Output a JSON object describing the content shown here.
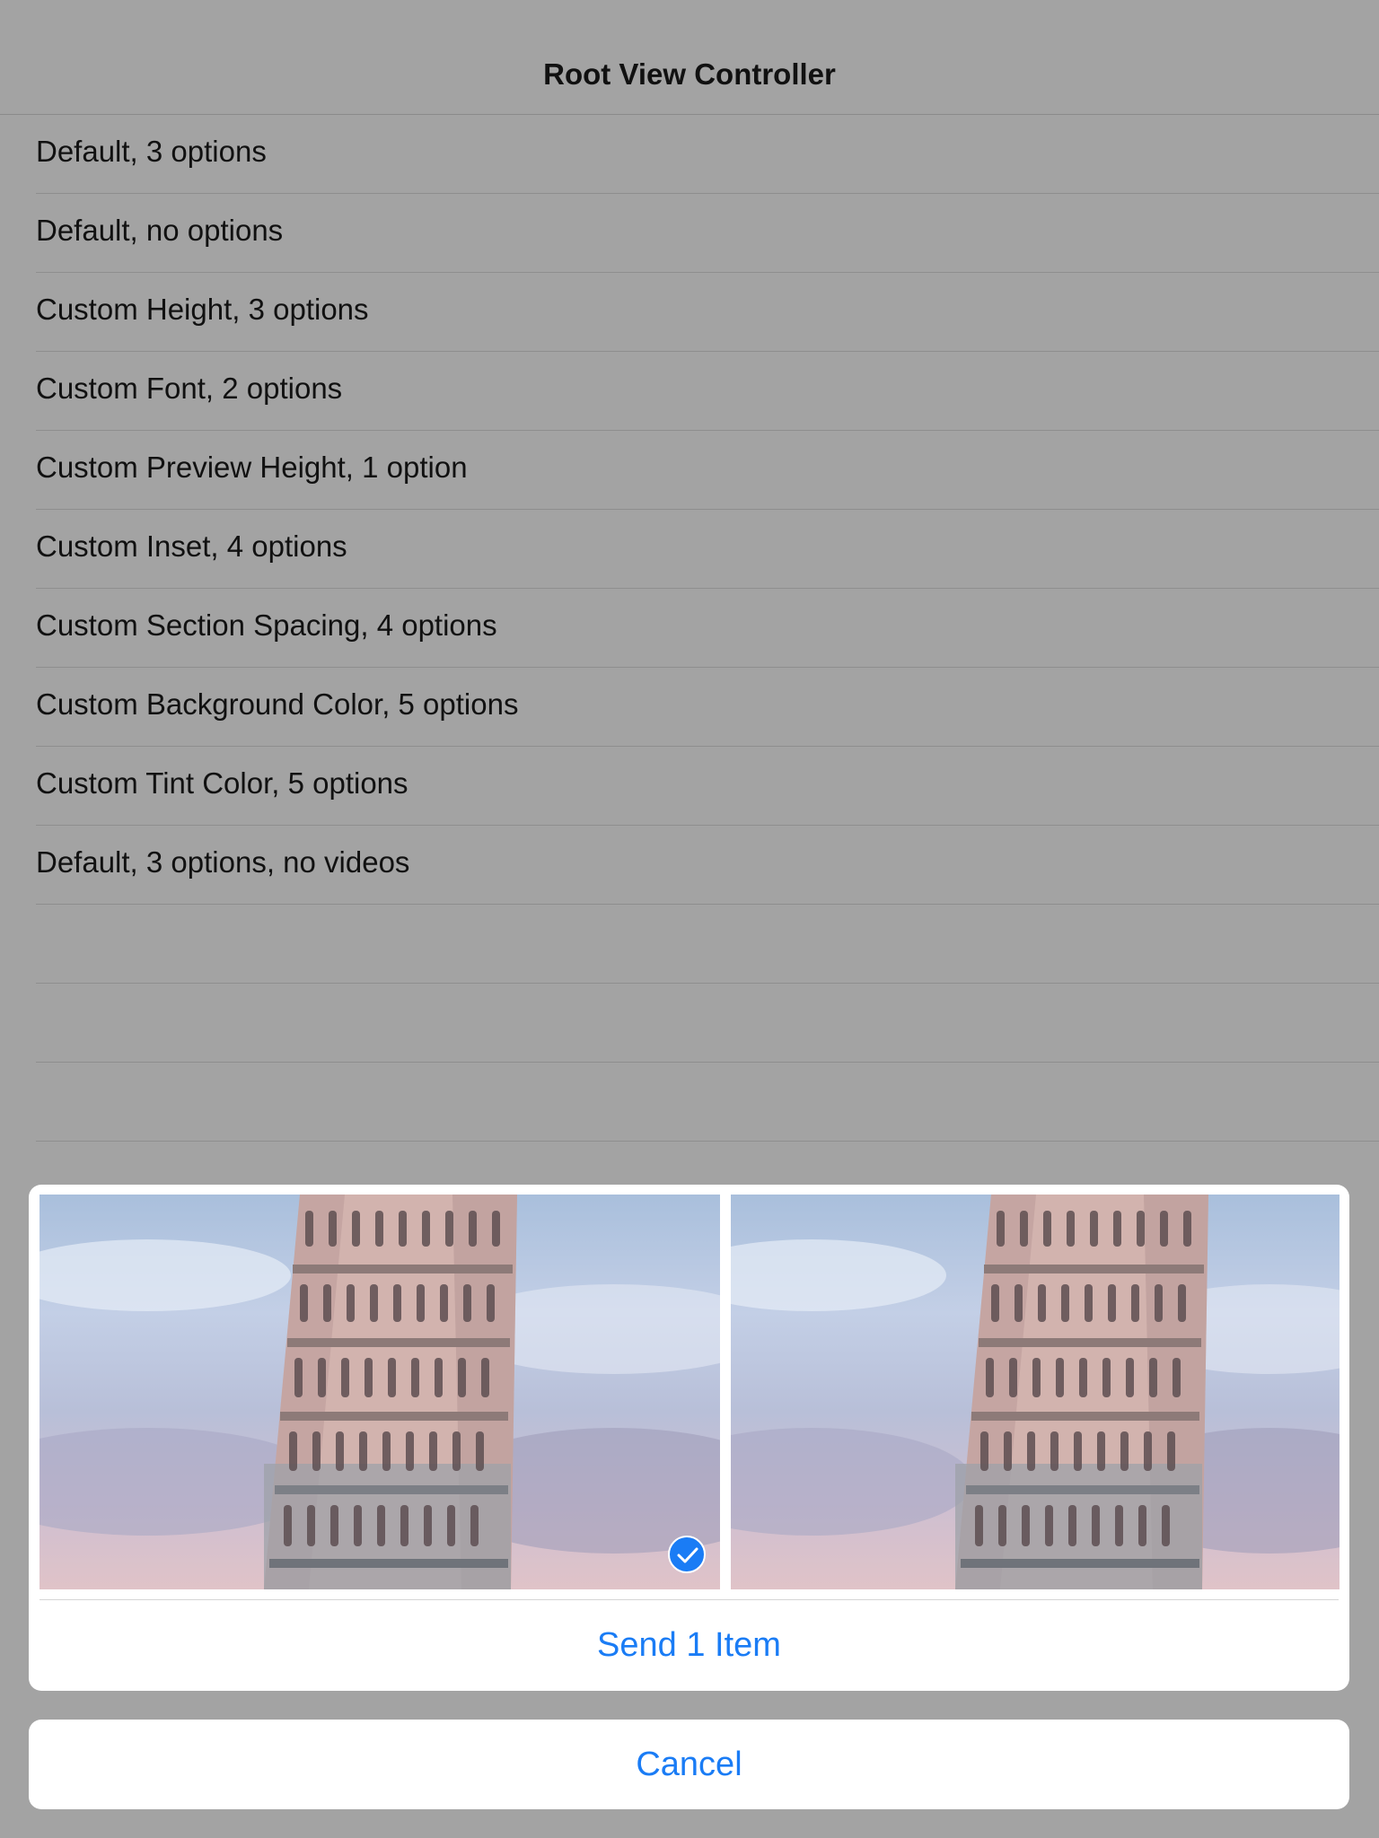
{
  "navbar": {
    "title": "Root View Controller"
  },
  "table": {
    "rows": [
      {
        "label": "Default, 3 options"
      },
      {
        "label": "Default, no options"
      },
      {
        "label": "Custom Height, 3 options"
      },
      {
        "label": "Custom Font, 2 options"
      },
      {
        "label": "Custom Preview Height, 1 option"
      },
      {
        "label": "Custom Inset, 4 options"
      },
      {
        "label": "Custom Section Spacing, 4 options"
      },
      {
        "label": "Custom Background Color, 5 options"
      },
      {
        "label": "Custom Tint Color, 5 options"
      },
      {
        "label": "Default, 3 options, no videos"
      }
    ]
  },
  "sheet": {
    "photos": [
      {
        "icon": "leaning-tower-photo",
        "selected": true
      },
      {
        "icon": "leaning-tower-photo",
        "selected": false
      }
    ],
    "send_label": "Send 1 Item",
    "cancel_label": "Cancel"
  },
  "colors": {
    "dimmed_background": "#a3a3a3",
    "tint": "#1a7cf5",
    "sheet_background": "#ffffff"
  }
}
